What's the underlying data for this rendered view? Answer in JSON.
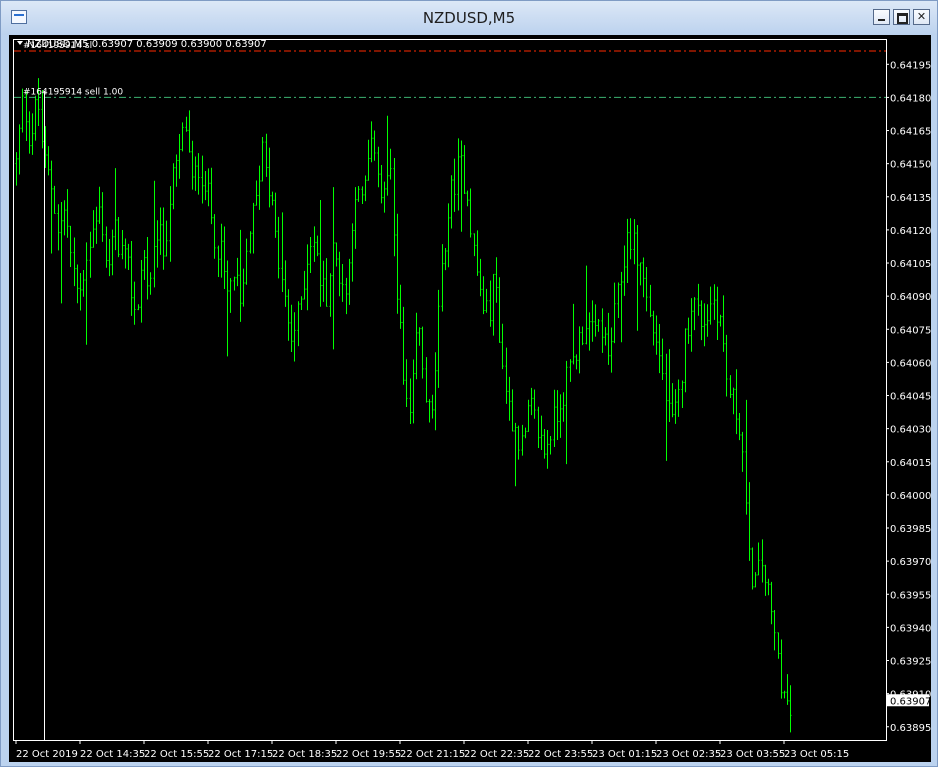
{
  "window": {
    "title": "NZDUSD,M5",
    "controls": [
      "minimize",
      "maximize",
      "close"
    ]
  },
  "colors": {
    "background": "#000000",
    "bar": "#00ff00",
    "sl_line": "#ff2a00",
    "entry_line": "#3cb371",
    "axis": "#ffffff"
  },
  "chart_data": {
    "type": "ohlc",
    "symbol_line": "NZDUSD,M5  0.63907 0.63909 0.63900 0.63907",
    "current_price": "0.63907",
    "ylim": [
      0.63889,
      0.64206
    ],
    "y_ticks": [
      "0.64195",
      "0.64180",
      "0.64165",
      "0.64150",
      "0.64135",
      "0.64120",
      "0.64105",
      "0.64090",
      "0.64075",
      "0.64060",
      "0.64045",
      "0.64030",
      "0.64015",
      "0.64000",
      "0.63985",
      "0.63970",
      "0.63955",
      "0.63940",
      "0.63925",
      "0.63910",
      "0.63895"
    ],
    "x_ticks": [
      "22 Oct 2019",
      "22 Oct 14:35",
      "22 Oct 15:55",
      "22 Oct 17:15",
      "22 Oct 18:35",
      "22 Oct 19:55",
      "22 Oct 21:15",
      "22 Oct 22:35",
      "22 Oct 23:55",
      "23 Oct 01:15",
      "23 Oct 02:35",
      "23 Oct 03:55",
      "23 Oct 05:15"
    ],
    "orders": [
      {
        "label": "#164195914 sl",
        "price": 0.64201,
        "kind": "sl"
      },
      {
        "label": "#164195914 sell 1.00",
        "price": 0.6418,
        "kind": "entry"
      }
    ],
    "close_path": [
      0.6415,
      0.6418,
      0.6416,
      0.6418,
      0.6415,
      0.6414,
      0.6412,
      0.6413,
      0.641,
      0.6409,
      0.6411,
      0.6412,
      0.6413,
      0.641,
      0.6412,
      0.6411,
      0.641,
      0.6408,
      0.6411,
      0.6409,
      0.6412,
      0.6411,
      0.6414,
      0.6415,
      0.6417,
      0.6414,
      0.6415,
      0.6414,
      0.6412,
      0.6411,
      0.6409,
      0.641,
      0.6408,
      0.6412,
      0.6413,
      0.6416,
      0.6414,
      0.6411,
      0.6409,
      0.6407,
      0.6408,
      0.641,
      0.6412,
      0.641,
      0.6409,
      0.6411,
      0.641,
      0.6409,
      0.6414,
      0.6413,
      0.6415,
      0.6416,
      0.6413,
      0.6415,
      0.641,
      0.6405,
      0.6403,
      0.6408,
      0.6405,
      0.6403,
      0.6408,
      0.6412,
      0.6414,
      0.6415,
      0.6414,
      0.6411,
      0.6409,
      0.6408,
      0.641,
      0.6406,
      0.6404,
      0.6403,
      0.6402,
      0.6404,
      0.6403,
      0.6402,
      0.6403,
      0.6404,
      0.6405,
      0.6406,
      0.6407,
      0.6408,
      0.6407,
      0.6408,
      0.6406,
      0.6408,
      0.641,
      0.6412,
      0.6411,
      0.641,
      0.6408,
      0.6407,
      0.6405,
      0.6403,
      0.6404,
      0.6407,
      0.6409,
      0.6408,
      0.6408,
      0.6409,
      0.6408,
      0.6405,
      0.6404,
      0.6403,
      0.6397,
      0.6396,
      0.6397,
      0.6395,
      0.6393,
      0.6391,
      0.639
    ]
  }
}
